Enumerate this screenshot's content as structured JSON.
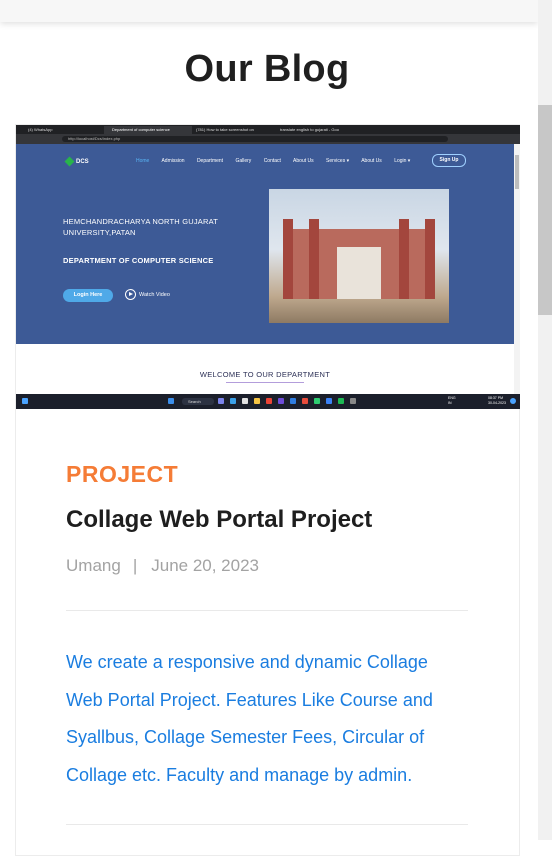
{
  "section": {
    "title": "Our Blog"
  },
  "screenshot": {
    "tabs": [
      "(4) WhatsApp",
      "Department of computer science",
      "(781) How to take screenshot on",
      "translate english to gujarati - Goo"
    ],
    "url": "http://localhost/Dcs/index.php",
    "site": {
      "logo": "DCS",
      "nav": [
        "Home",
        "Admission",
        "Department",
        "Gallery",
        "Contact",
        "About Us",
        "Services ▾",
        "About Us",
        "Login ▾"
      ],
      "signup": "Sign Up",
      "university_line1": "HEMCHANDRACHARYA NORTH GUJARAT",
      "university_line2": "UNIVERSITY,PATAN",
      "department": "DEPARTMENT OF COMPUTER SCIENCE",
      "login_button": "Login Here",
      "watch_video": "Watch Video",
      "welcome": "WELCOME TO OUR DEPARTMENT"
    },
    "taskbar": {
      "search": "Search",
      "lang_top": "ENG",
      "lang_bottom": "IN",
      "time": "08:37 PM",
      "date": "30-04-2023"
    },
    "colors": {
      "hero": "#3d5a96",
      "taskbar": "#1b1f2b"
    }
  },
  "post": {
    "category": "PROJECT",
    "title": "Collage Web Portal Project",
    "author": "Umang",
    "separator": "|",
    "date": "June 20, 2023",
    "excerpt": "We create a responsive and dynamic Collage Web Portal Project. Features Like Course and Syallbus, Collage Semester Fees, Circular of Collage etc. Faculty and manage by admin."
  },
  "colors": {
    "category": "#f57c36",
    "excerpt": "#1a7de0",
    "meta": "#a3a3a3"
  }
}
